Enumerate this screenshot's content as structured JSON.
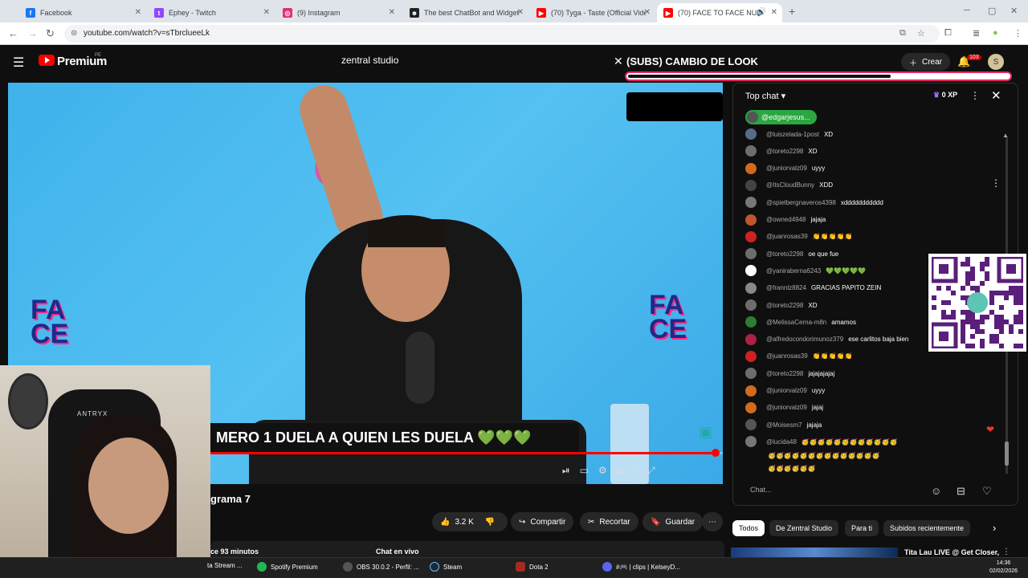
{
  "browser": {
    "tabs": [
      {
        "label": "Facebook",
        "icon": "facebook-icon",
        "color": "#1877f2",
        "glyph": "f"
      },
      {
        "label": "Ephey - Twitch",
        "icon": "twitch-icon",
        "color": "#9146ff",
        "glyph": "t"
      },
      {
        "label": "(9) Instagram",
        "icon": "instagram-icon",
        "color": "#e1306c",
        "glyph": "◎"
      },
      {
        "label": "The best ChatBot and Widgets",
        "icon": "chatbot-icon",
        "color": "#222222",
        "glyph": "☻"
      },
      {
        "label": "(70) Tyga - Taste (Official Video)",
        "icon": "youtube-icon",
        "color": "#ff0000",
        "glyph": "▶"
      },
      {
        "label": "(70) FACE TO FACE NUEVA",
        "icon": "youtube-icon",
        "color": "#ff0000",
        "glyph": "▶"
      }
    ],
    "url": "youtube.com/watch?v=sTbrclueeLk"
  },
  "youtube": {
    "brand": "Premium",
    "region": "PE",
    "search_value": "zentral studio",
    "create_label": "Crear",
    "notif_count": "103",
    "avatar_letter": "S"
  },
  "overlay": {
    "title": "(SUBS) CAMBIO DE LOOK",
    "progress": 0.69
  },
  "video": {
    "ticker": "MERO 1 DUELA A QUIEN LES DUELA 💚💚💚",
    "logo_text": "FACE TO FACE",
    "progress": 0.99,
    "title_fragment": "grama 7",
    "likes": "3.2 K",
    "share_label": "Compartir",
    "clip_label": "Recortar",
    "save_label": "Guardar",
    "desc_fragment": "ce 93 minutos",
    "live_chat_label": "Chat en vivo",
    "webcam_brand": "ANTRYX"
  },
  "chat": {
    "mode": "Top chat",
    "xp": "0 XP",
    "pinned_user": "@edgarjesus...",
    "input_placeholder": "Chat...",
    "messages": [
      {
        "author": "@luiszelada-1post",
        "text": "XD",
        "color": "#5a6a8a"
      },
      {
        "author": "@toreto2298",
        "text": "XD",
        "color": "#6d6d6d"
      },
      {
        "author": "@juniorvalz09",
        "text": "uyyy",
        "color": "#d2691e"
      },
      {
        "author": "@ItsCloudBunny",
        "text": "XDD",
        "color": "#444444"
      },
      {
        "author": "@spielbergnaveros4398",
        "text": "xddddddddddd",
        "color": "#777777"
      },
      {
        "author": "@owned4948",
        "text": "jajaja",
        "color": "#c0562b"
      },
      {
        "author": "@juanrosas39",
        "text": "👏👏👏👏👏",
        "color": "#cc2222"
      },
      {
        "author": "@toreto2298",
        "text": "oe que fue",
        "color": "#6d6d6d"
      },
      {
        "author": "@yaniraberna6243",
        "text": "💚💚💚💚💚",
        "color": "#ffffff"
      },
      {
        "author": "@frannlz8824",
        "text": "GRACIAS PAPITO ZEIN",
        "color": "#888888"
      },
      {
        "author": "@toreto2298",
        "text": "XD",
        "color": "#6d6d6d"
      },
      {
        "author": "@MelissaCerna-m8n",
        "text": "amamos",
        "color": "#2e7d32"
      },
      {
        "author": "@alfredocondorimunoz379",
        "text": "ese carlitos baja bien",
        "color": "#aa2244"
      },
      {
        "author": "@juanrosas39",
        "text": "👏👏👏👏👏",
        "color": "#cc2222"
      },
      {
        "author": "@toreto2298",
        "text": "jajajajajaj",
        "color": "#6d6d6d"
      },
      {
        "author": "@juniorvalz09",
        "text": "uyyy",
        "color": "#d2691e"
      },
      {
        "author": "@juniorvalz09",
        "text": "jajaj",
        "color": "#d2691e"
      },
      {
        "author": "@Moisesm7",
        "text": "jajaja",
        "color": "#555555"
      },
      {
        "author": "@lucida48",
        "text": "🥳🥳🥳🥳🥳🥳🥳🥳🥳🥳🥳🥳",
        "color": "#777777"
      }
    ],
    "emoji_lines": [
      "🥳🥳🥳🥳🥳🥳🥳🥳🥳🥳🥳🥳🥳🥳",
      "🥳🥳🥳🥳🥳🥳"
    ]
  },
  "filters": [
    "Todos",
    "De Zentral Studio",
    "Para ti",
    "Subidos recientemente"
  ],
  "recommendation": "Tita Lau LIVE @ Get Closer,",
  "taskbar": {
    "items": [
      {
        "label": "ta Stream ...",
        "color": "#9146ff"
      },
      {
        "label": "Spotify Premium",
        "color": "#1db954"
      },
      {
        "label": "OBS 30.0.2 - Perfil: ...",
        "color": "#302e31"
      },
      {
        "label": "Steam",
        "color": "#1b2838"
      },
      {
        "label": "Dota 2",
        "color": "#a32b1f"
      },
      {
        "label": "#🎮 | clips | KelseyD...",
        "color": "#5865f2"
      }
    ],
    "time": "14:36",
    "date": "02/02/2026"
  }
}
